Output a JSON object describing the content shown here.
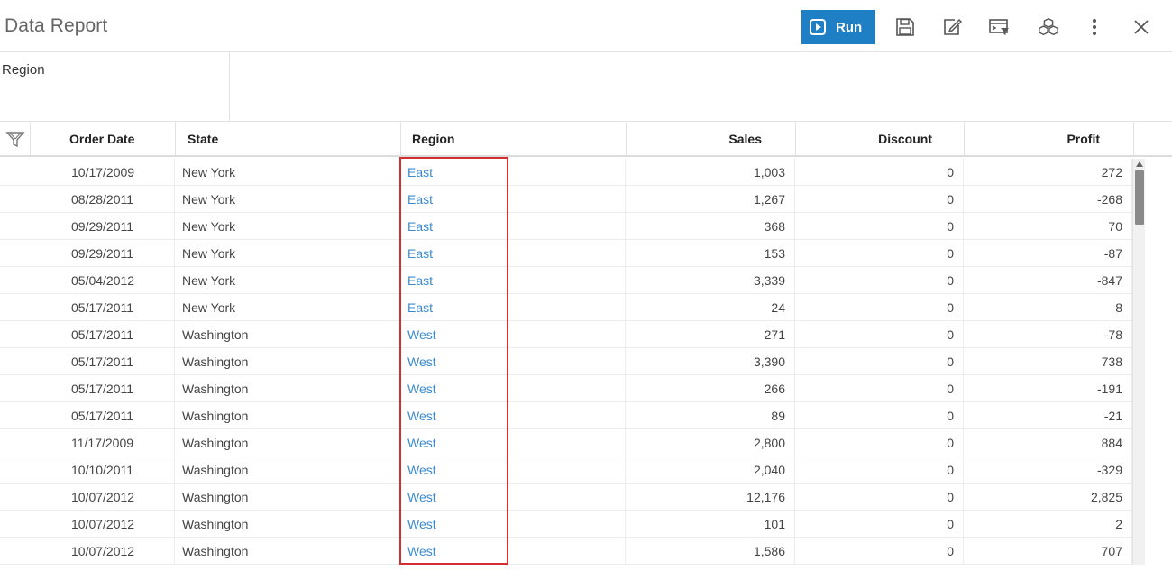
{
  "header": {
    "title": "Data Report",
    "run_label": "Run",
    "accent_color": "#1f7fc4",
    "tools": [
      "save-icon",
      "edit-icon",
      "filter-panel-icon",
      "cubes-icon",
      "more-vertical-icon",
      "close-icon"
    ]
  },
  "filter_pane": {
    "region_label": "Region"
  },
  "grid": {
    "columns": [
      "Order Date",
      "State",
      "Region",
      "Sales",
      "Discount",
      "Profit"
    ],
    "highlighted_column": "Region",
    "highlight_color": "#d32f2f",
    "link_color": "#3b8bd0",
    "rows": [
      [
        "10/17/2009",
        "New York",
        "East",
        "1,003",
        "0",
        "272"
      ],
      [
        "08/28/2011",
        "New York",
        "East",
        "1,267",
        "0",
        "-268"
      ],
      [
        "09/29/2011",
        "New York",
        "East",
        "368",
        "0",
        "70"
      ],
      [
        "09/29/2011",
        "New York",
        "East",
        "153",
        "0",
        "-87"
      ],
      [
        "05/04/2012",
        "New York",
        "East",
        "3,339",
        "0",
        "-847"
      ],
      [
        "05/17/2011",
        "New York",
        "East",
        "24",
        "0",
        "8"
      ],
      [
        "05/17/2011",
        "Washington",
        "West",
        "271",
        "0",
        "-78"
      ],
      [
        "05/17/2011",
        "Washington",
        "West",
        "3,390",
        "0",
        "738"
      ],
      [
        "05/17/2011",
        "Washington",
        "West",
        "266",
        "0",
        "-191"
      ],
      [
        "05/17/2011",
        "Washington",
        "West",
        "89",
        "0",
        "-21"
      ],
      [
        "11/17/2009",
        "Washington",
        "West",
        "2,800",
        "0",
        "884"
      ],
      [
        "10/10/2011",
        "Washington",
        "West",
        "2,040",
        "0",
        "-329"
      ],
      [
        "10/07/2012",
        "Washington",
        "West",
        "12,176",
        "0",
        "2,825"
      ],
      [
        "10/07/2012",
        "Washington",
        "West",
        "101",
        "0",
        "2"
      ],
      [
        "10/07/2012",
        "Washington",
        "West",
        "1,586",
        "0",
        "707"
      ]
    ]
  }
}
